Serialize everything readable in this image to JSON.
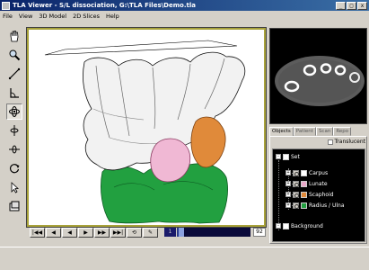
{
  "window": {
    "title": "TLA Viewer - S/L dissociation, G:\\TLA Files\\Demo.tla",
    "controls": [
      "_",
      "□",
      "x"
    ]
  },
  "menu": [
    "File",
    "View",
    "3D Model",
    "2D Slices",
    "Help"
  ],
  "toolbar": {
    "tools": [
      {
        "name": "pan-hand-icon"
      },
      {
        "name": "zoom-magnifier-icon"
      },
      {
        "name": "measure-line-icon"
      },
      {
        "name": "angle-icon"
      },
      {
        "name": "rotate-3d-icon",
        "active": true
      },
      {
        "name": "rotate-vertical-icon"
      },
      {
        "name": "rotate-horizontal-icon"
      },
      {
        "name": "rotate-cycle-icon"
      },
      {
        "name": "pointer-icon"
      },
      {
        "name": "snapshot-icon"
      }
    ]
  },
  "playback": {
    "buttons": [
      "|◀◀",
      "◀",
      "◀",
      "▶",
      "▶▶",
      "▶▶|",
      "⟲",
      "✎"
    ],
    "current_frame": "1",
    "total_frames": "92",
    "progress": 0.02
  },
  "side_panel": {
    "tabs": [
      "Objects",
      "Patient",
      "Scan",
      "Repo"
    ],
    "active_tab": "Objects",
    "translucent_label": "Translucent",
    "tree": {
      "set_label": "Set",
      "items": [
        {
          "label": "Carpus",
          "color": "#ffffff"
        },
        {
          "label": "Lunate",
          "color": "#e8a8c8"
        },
        {
          "label": "Scaphoid",
          "color": "#e08a3a"
        },
        {
          "label": "Radius / Ulna",
          "color": "#22a040"
        }
      ],
      "background_label": "Background"
    }
  },
  "colors": {
    "viewport_border": "#a8a23a",
    "title_gradient_start": "#0a246a",
    "carpus": "#ffffff",
    "lunate": "#e8a8c8",
    "scaphoid": "#e08a3a",
    "radius_ulna": "#22a040"
  }
}
